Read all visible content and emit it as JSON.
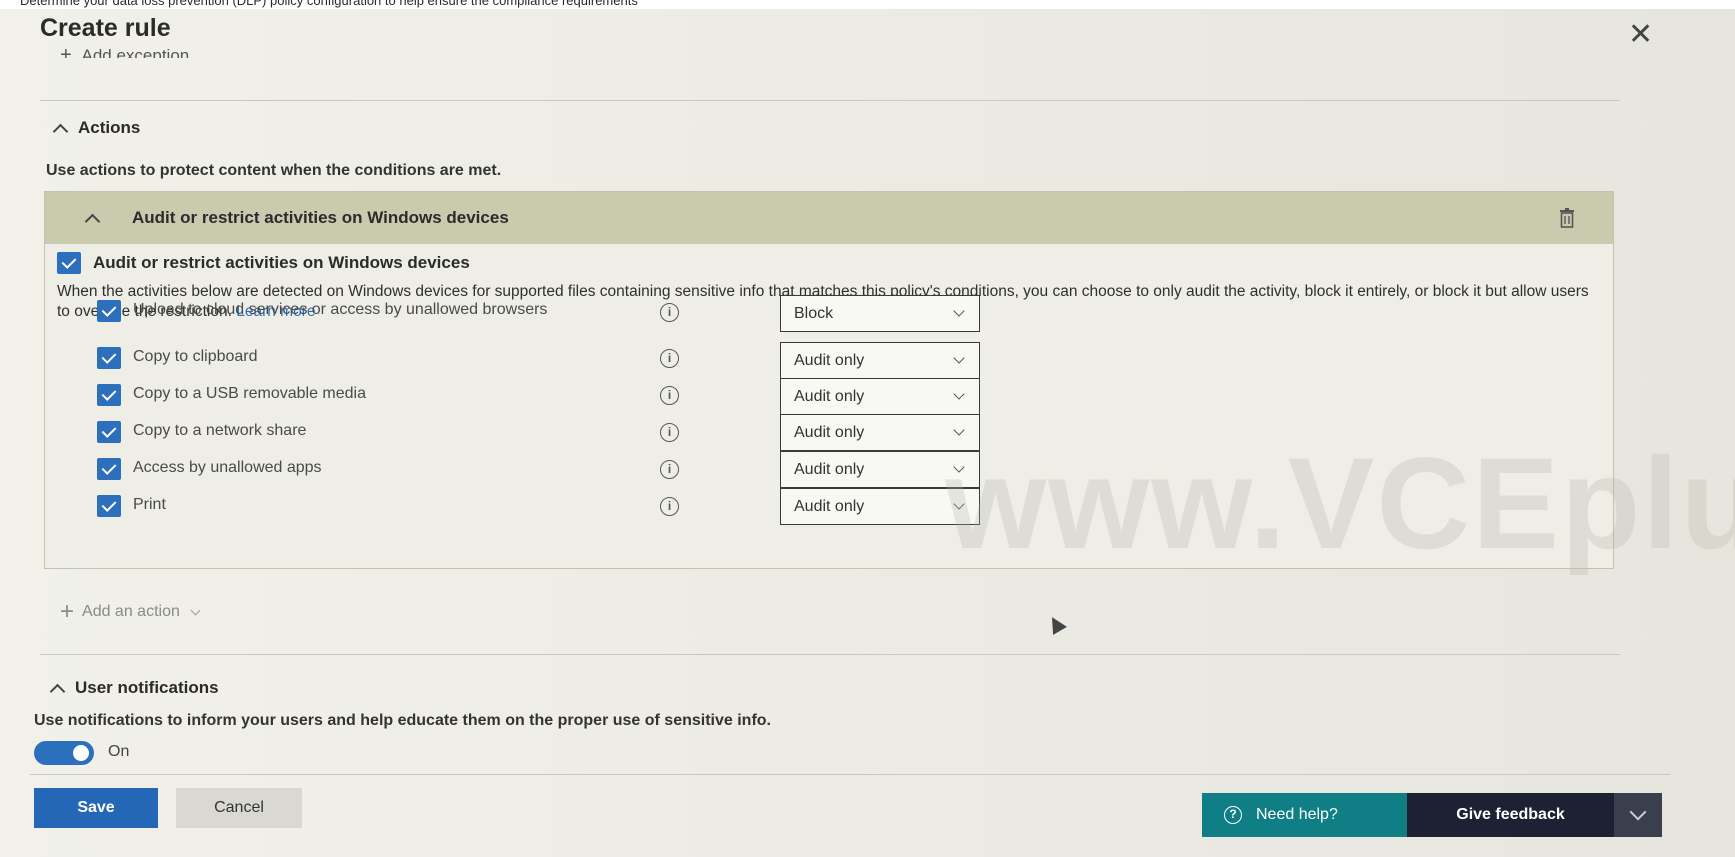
{
  "window": {
    "title": "Create rule",
    "close_glyph": "✕",
    "top_strip_text": "Determine your data loss prevention (DLP) policy configuration to help ensure the compliance requirements"
  },
  "conditions": {
    "add_exception_label": "Add exception"
  },
  "actions_section": {
    "title": "Actions",
    "description": "Use actions to protect content when the conditions are met.",
    "card": {
      "header_title": "Audit or restrict activities on Windows devices",
      "checkbox_label": "Audit or restrict activities on Windows devices",
      "description": "When the activities below are detected on Windows devices for supported files containing sensitive info that matches this policy's conditions, you can choose to only audit the activity, block it entirely, or block it but allow users to override the restriction.",
      "learn_more": "Learn more",
      "activities": [
        {
          "label": "Upload to cloud services or access by unallowed browsers",
          "value": "Block",
          "checked": true
        },
        {
          "label": "Copy to clipboard",
          "value": "Audit only",
          "checked": true
        },
        {
          "label": "Copy to a USB removable media",
          "value": "Audit only",
          "checked": true
        },
        {
          "label": "Copy to a network share",
          "value": "Audit only",
          "checked": true
        },
        {
          "label": "Access by unallowed apps",
          "value": "Audit only",
          "checked": true
        },
        {
          "label": "Print",
          "value": "Audit only",
          "checked": true
        }
      ]
    },
    "add_action_label": "Add an action"
  },
  "notifications_section": {
    "title": "User notifications",
    "description": "Use notifications to inform your users and help educate them on the proper use of sensitive info.",
    "toggle_label": "On",
    "toggle_on": true
  },
  "footer": {
    "save_label": "Save",
    "cancel_label": "Cancel",
    "help_label": "Need help?",
    "feedback_label": "Give feedback"
  },
  "watermark": "www.VCEplu",
  "icons": {
    "info": "info-circle-icon",
    "trash": "trash-icon",
    "close": "close-icon",
    "chevron_up": "chevron-up-icon",
    "chevron_down": "chevron-down-icon",
    "help": "question-circle-icon"
  },
  "colors": {
    "accent_blue": "#2b6fbd",
    "card_header": "#c9caae",
    "help_teal": "#0f7f85",
    "feedback_navy": "#1c2233"
  }
}
